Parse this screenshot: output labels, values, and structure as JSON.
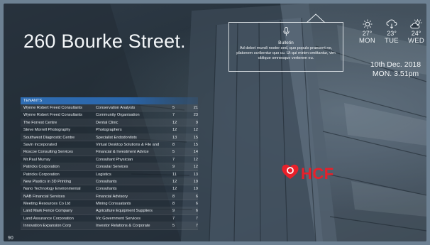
{
  "title": "260 Bourke Street.",
  "bulletin": {
    "heading": "Bulletin",
    "body": "Ad debet mundi noster sed, quo populo praesent ne, platonem scribentur quo cu. Ut qui minim omittantur, vim oblique omnesque verterem eu."
  },
  "weather": [
    {
      "icon": "sun-icon",
      "temp": "27°",
      "day": "MON"
    },
    {
      "icon": "rain-cloud-icon",
      "temp": "23°",
      "day": "TUE"
    },
    {
      "icon": "partly-cloudy-icon",
      "temp": "24°",
      "day": "WED"
    }
  ],
  "date": "10th Dec. 2018",
  "time": "MON. 3.51pm",
  "tenants": {
    "heading": "TENANTS",
    "rows": [
      {
        "name": "Wynne Robert Freed Consultants",
        "category": "Conservation Analysts",
        "level": "5",
        "suite": "21"
      },
      {
        "name": "Wynne Robert Freed Consultants",
        "category": "Community Organisation",
        "level": "7",
        "suite": "23"
      },
      {
        "name": "The Forrest Centre",
        "category": "Dental Clinic",
        "level": "12",
        "suite": "9"
      },
      {
        "name": "Steve Morrell Photography",
        "category": "Photographers",
        "level": "12",
        "suite": "12"
      },
      {
        "name": "Southwest Diagnostic Centre",
        "category": "Specialist Endodontists",
        "level": "13",
        "suite": "15"
      },
      {
        "name": "Savin Incorporated",
        "category": "Virtual Desktop Solutions & File and",
        "level": "8",
        "suite": "15"
      },
      {
        "name": "Roscoe Consulting Services",
        "category": "Financial & Investment Advice",
        "level": "5",
        "suite": "14"
      },
      {
        "name": "Mr.Paul Murray",
        "category": "Consultant Physician",
        "level": "7",
        "suite": "12"
      },
      {
        "name": "Patricks Corporation",
        "category": "Consular Services",
        "level": "9",
        "suite": "12"
      },
      {
        "name": "Patricks Corporation",
        "category": "Logistics",
        "level": "11",
        "suite": "13"
      },
      {
        "name": "New Plastics in 3D Printing",
        "category": "Consultants",
        "level": "12",
        "suite": "19"
      },
      {
        "name": "Nano Technology Environmental",
        "category": "Consultants",
        "level": "12",
        "suite": "19"
      },
      {
        "name": "NAB Financial Services",
        "category": "Financial Advisory",
        "level": "8",
        "suite": "6"
      },
      {
        "name": "Meeting Resources Co Ltd",
        "category": "Mining Consuatants",
        "level": "8",
        "suite": "6"
      },
      {
        "name": "Land Mark Fence Company",
        "category": "Agriculture Equipment Suppliers",
        "level": "9",
        "suite": "6"
      },
      {
        "name": "Land Assurance Corporation",
        "category": "Vic Government Services",
        "level": "7",
        "suite": "7"
      },
      {
        "name": "Innovation Expansion Corp",
        "category": "Investor Relations & Corporate",
        "level": "5",
        "suite": "7"
      }
    ]
  },
  "logo": {
    "text": "HCF",
    "color": "#e8202a"
  },
  "corner_mark": "90"
}
